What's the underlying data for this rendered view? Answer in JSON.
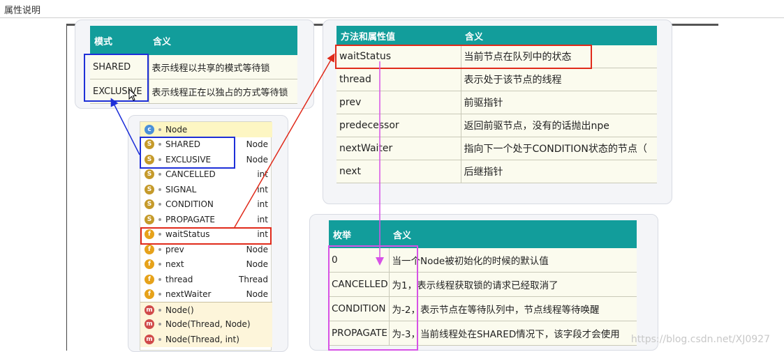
{
  "header": {
    "title": "属性说明"
  },
  "mode_table": {
    "headers": [
      "模式",
      "含义"
    ],
    "rows": [
      [
        "SHARED",
        "表示线程以共享的模式等待锁"
      ],
      [
        "EXCLUSIVE",
        "表示线程正在以独占的方式等待锁"
      ]
    ]
  },
  "method_table": {
    "headers": [
      "方法和属性值",
      "含义"
    ],
    "rows": [
      [
        "waitStatus",
        "当前节点在队列中的状态"
      ],
      [
        "thread",
        "表示处于该节点的线程"
      ],
      [
        "prev",
        "前驱指针"
      ],
      [
        "predecessor",
        "返回前驱节点，没有的话抛出npe"
      ],
      [
        "nextWaiter",
        "指向下一个处于CONDITION状态的节点（"
      ],
      [
        "next",
        "后继指针"
      ]
    ]
  },
  "enum_table": {
    "headers": [
      "枚举",
      "含义"
    ],
    "rows": [
      [
        "0",
        "当一个Node被初始化的时候的默认值"
      ],
      [
        "CANCELLED",
        "为1，表示线程获取锁的请求已经取消了"
      ],
      [
        "CONDITION",
        "为-2，表示节点在等待队列中，节点线程等待唤醒"
      ],
      [
        "PROPAGATE",
        "为-3，当前线程处在SHARED情况下，该字段才会使用"
      ]
    ]
  },
  "node_class": {
    "name": "Node",
    "fields": [
      {
        "icon": "static-field-icon",
        "name": "SHARED",
        "type": "Node"
      },
      {
        "icon": "static-field-icon",
        "name": "EXCLUSIVE",
        "type": "Node"
      },
      {
        "icon": "static-field-icon",
        "name": "CANCELLED",
        "type": "int"
      },
      {
        "icon": "static-field-icon",
        "name": "SIGNAL",
        "type": "int"
      },
      {
        "icon": "static-field-icon",
        "name": "CONDITION",
        "type": "int"
      },
      {
        "icon": "static-field-icon",
        "name": "PROPAGATE",
        "type": "int"
      },
      {
        "icon": "field-icon",
        "name": "waitStatus",
        "type": "int"
      },
      {
        "icon": "field-icon",
        "name": "prev",
        "type": "Node"
      },
      {
        "icon": "field-icon",
        "name": "next",
        "type": "Node"
      },
      {
        "icon": "field-icon",
        "name": "thread",
        "type": "Thread"
      },
      {
        "icon": "field-icon",
        "name": "nextWaiter",
        "type": "Node"
      }
    ],
    "methods": [
      {
        "icon": "method-icon",
        "name": "Node()"
      },
      {
        "icon": "method-icon",
        "name": "Node(Thread, Node)"
      },
      {
        "icon": "method-icon",
        "name": "Node(Thread, int)"
      }
    ]
  },
  "icons": {
    "class": "c",
    "static": "S",
    "field": "f",
    "method": "m"
  },
  "colors": {
    "teal_header": "#129d9b",
    "highlight_blue": "#1d2fd8",
    "highlight_red": "#e02a1a",
    "highlight_magenta": "#d752e6"
  },
  "watermark": "https://blog.csdn.net/XJ0927"
}
